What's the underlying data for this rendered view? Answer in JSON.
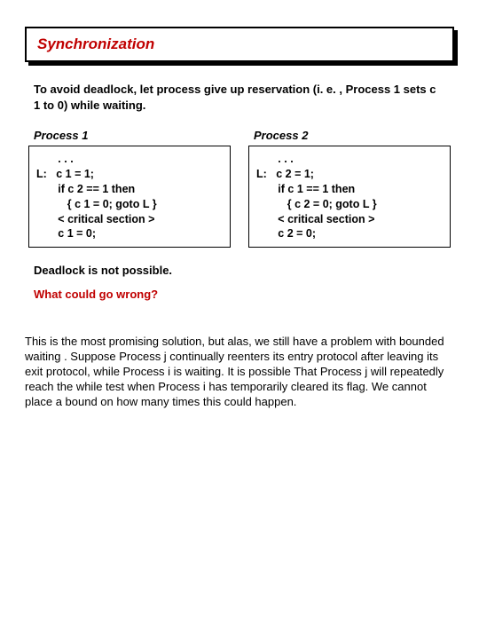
{
  "title": "Synchronization",
  "intro": "To avoid deadlock, let process give up reservation (i. e. , Process 1 sets c 1 to 0) while waiting.",
  "process1": {
    "title": "Process 1",
    "code": "       . . .\nL:   c 1 = 1;\n       if c 2 == 1 then\n          { c 1 = 0; goto L }\n       < critical section >\n       c 1 = 0;"
  },
  "process2": {
    "title": "Process 2",
    "code": "       . . .\nL:   c 2 = 1;\n       if c 1 == 1 then\n          { c 2 = 0; goto L }\n       < critical section >\n       c 2 = 0;"
  },
  "statement": "Deadlock is not possible.",
  "question": "What could go wrong?",
  "notes": "This is the most promising solution, but alas, we still have a problem with bounded waiting . Suppose Process j continually reenters its entry protocol after leaving its exit protocol, while Process i is waiting. It is possible That Process j will repeatedly reach the while test when Process i has temporarily cleared its flag. We cannot place a bound on how many times this could happen."
}
